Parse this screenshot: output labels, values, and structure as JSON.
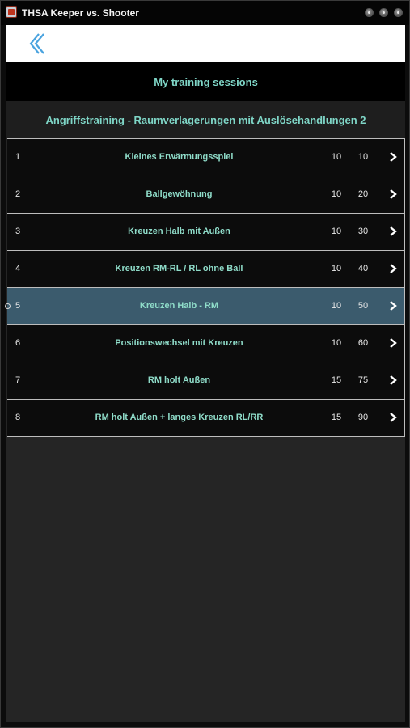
{
  "window": {
    "title": "THSA Keeper vs. Shooter",
    "icon": "app-icon",
    "controls": [
      "minimize-icon",
      "maximize-icon",
      "close-icon"
    ]
  },
  "nav": {
    "back_icon": "chevron-left-icon"
  },
  "header": {
    "title": "My training sessions"
  },
  "session": {
    "title": "Angriffstraining - Raumverlagerungen mit Auslösehandlungen 2"
  },
  "colors": {
    "accent_text": "#7fd6c7",
    "selected_row": "#3b5b6d",
    "back_icon": "#4aa3df"
  },
  "exercises": [
    {
      "num": "1",
      "name": "Kleines Erwärmungsspiel",
      "duration": "10",
      "total": "10"
    },
    {
      "num": "2",
      "name": "Ballgewöhnung",
      "duration": "10",
      "total": "20"
    },
    {
      "num": "3",
      "name": "Kreuzen Halb mit Außen",
      "duration": "10",
      "total": "30"
    },
    {
      "num": "4",
      "name": "Kreuzen RM-RL / RL ohne Ball",
      "duration": "10",
      "total": "40"
    },
    {
      "num": "5",
      "name": "Kreuzen Halb - RM",
      "duration": "10",
      "total": "50"
    },
    {
      "num": "6",
      "name": "Positionswechsel mit Kreuzen",
      "duration": "10",
      "total": "60"
    },
    {
      "num": "7",
      "name": "RM holt Außen",
      "duration": "15",
      "total": "75"
    },
    {
      "num": "8",
      "name": "RM holt Außen + langes Kreuzen RL/RR",
      "duration": "15",
      "total": "90"
    }
  ],
  "selected_index": 4
}
